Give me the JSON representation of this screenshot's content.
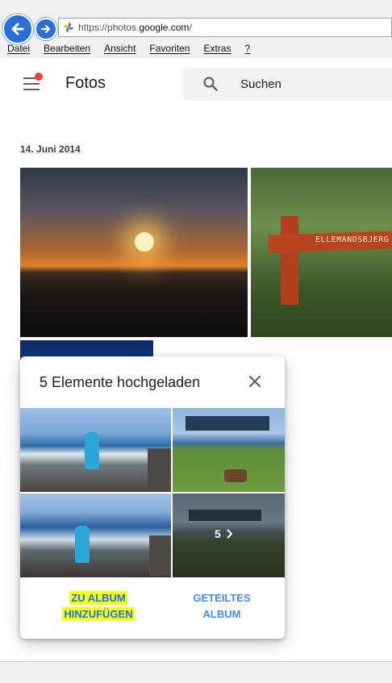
{
  "browser": {
    "url_prefix": "https://photos.",
    "url_domain": "google.com",
    "url_suffix": "/",
    "menu": [
      "Datei",
      "Bearbeiten",
      "Ansicht",
      "Favoriten",
      "Extras",
      "?"
    ]
  },
  "app": {
    "title": "Fotos",
    "search_placeholder": "Suchen"
  },
  "section": {
    "date": "14. Juni 2014"
  },
  "photos": {
    "sign_text": "ELLEMANDSBJERG"
  },
  "dialog": {
    "title": "5 Elemente hochgeladen",
    "more_count": "5",
    "add_to_album_line1": "ZU ALBUM",
    "add_to_album_line2": "HINZUFÜGEN",
    "shared_album_line1": "GETEILTES",
    "shared_album_line2": "ALBUM"
  },
  "colors": {
    "accent_blue": "#1a73e8",
    "highlight": "#f6ff19",
    "notification": "#ea4335"
  }
}
